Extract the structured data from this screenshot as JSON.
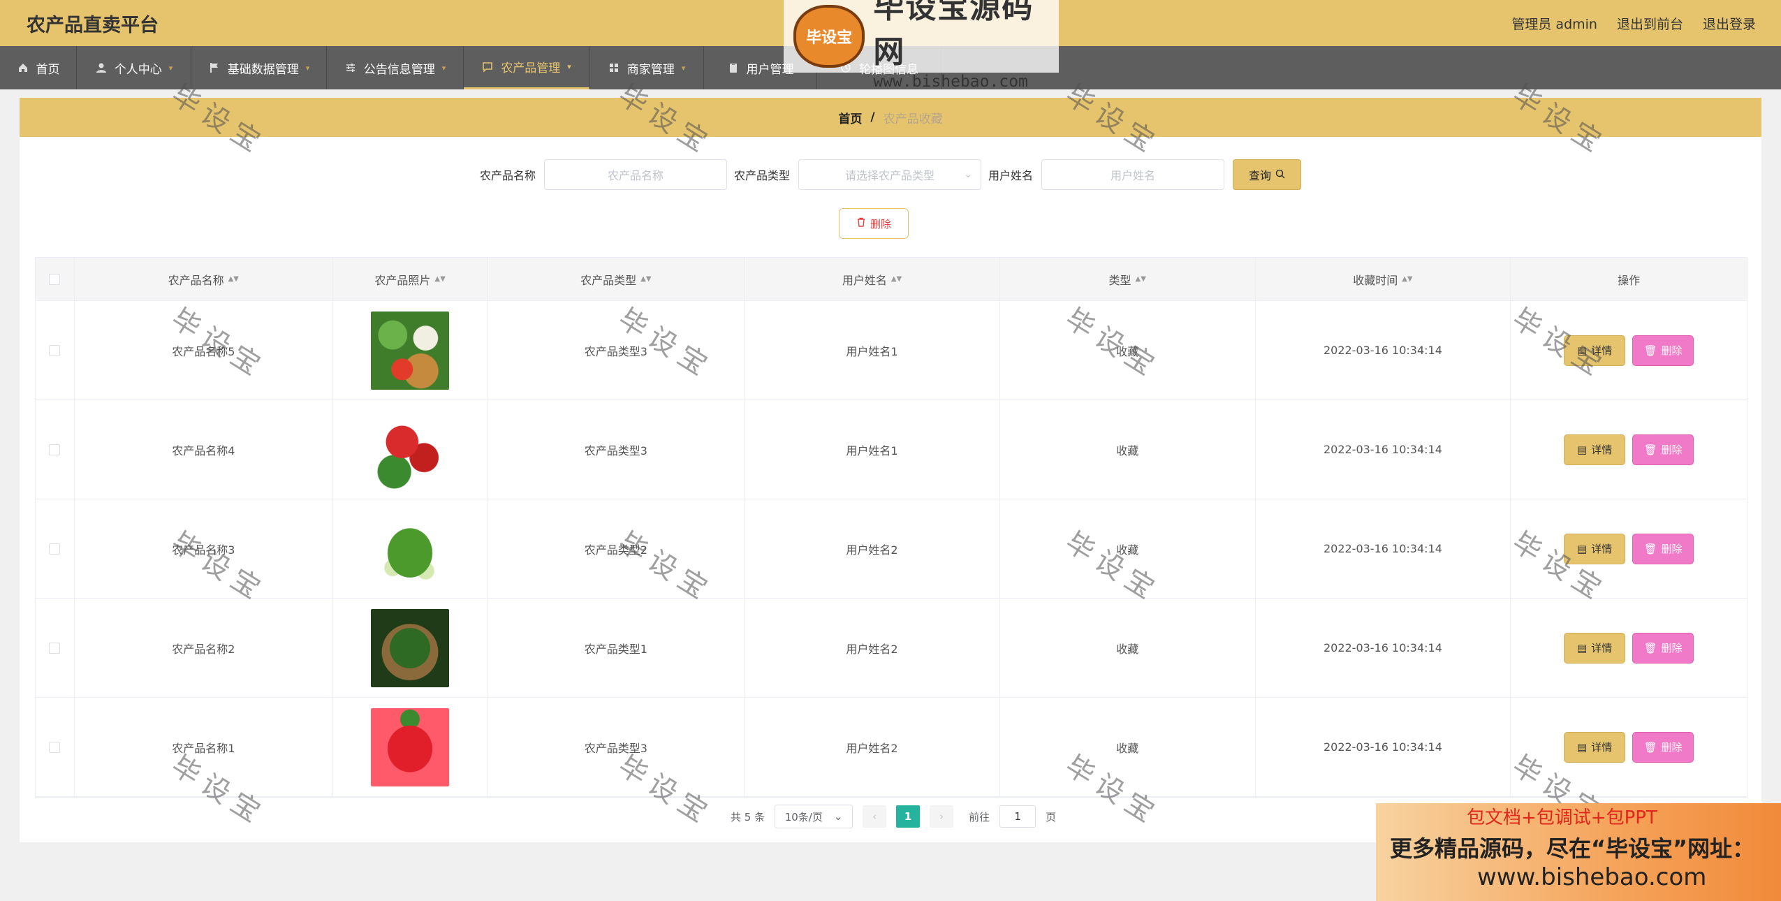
{
  "header": {
    "app_title": "农产品直卖平台",
    "admin_label": "管理员 admin",
    "front_link": "退出到前台",
    "logout_link": "退出登录"
  },
  "nav": [
    {
      "label": "首页",
      "icon": "home-icon",
      "dropdown": false,
      "active": false
    },
    {
      "label": "个人中心",
      "icon": "user-icon",
      "dropdown": true,
      "active": false
    },
    {
      "label": "基础数据管理",
      "icon": "flag-icon",
      "dropdown": true,
      "active": false
    },
    {
      "label": "公告信息管理",
      "icon": "sliders-icon",
      "dropdown": true,
      "active": false
    },
    {
      "label": "农产品管理",
      "icon": "message-icon",
      "dropdown": true,
      "active": true
    },
    {
      "label": "商家管理",
      "icon": "grid-icon",
      "dropdown": true,
      "active": false
    },
    {
      "label": "用户管理",
      "icon": "clipboard-icon",
      "dropdown": false,
      "active": false
    },
    {
      "label": "轮播图信息",
      "icon": "clock-icon",
      "dropdown": false,
      "active": false
    }
  ],
  "watermark": {
    "badge": "毕设宝",
    "main": "毕设宝源码网",
    "url": "www.bishebao.com",
    "overlay_text": "毕设宝"
  },
  "breadcrumb": {
    "home": "首页",
    "separator": "/",
    "current": "农产品收藏"
  },
  "filters": {
    "name_label": "农产品名称",
    "name_placeholder": "农产品名称",
    "type_label": "农产品类型",
    "type_placeholder": "请选择农产品类型",
    "user_label": "用户姓名",
    "user_placeholder": "用户姓名",
    "query_button": "查询"
  },
  "batch_delete_button": "删除",
  "table": {
    "columns": [
      "农产品名称",
      "农产品照片",
      "农产品类型",
      "用户姓名",
      "类型",
      "收藏时间",
      "操作"
    ],
    "rows": [
      {
        "name": "农产品名称5",
        "type": "农产品类型3",
        "user": "用户姓名1",
        "kind": "收藏",
        "time": "2022-03-16 10:34:14"
      },
      {
        "name": "农产品名称4",
        "type": "农产品类型3",
        "user": "用户姓名1",
        "kind": "收藏",
        "time": "2022-03-16 10:34:14"
      },
      {
        "name": "农产品名称3",
        "type": "农产品类型2",
        "user": "用户姓名2",
        "kind": "收藏",
        "time": "2022-03-16 10:34:14"
      },
      {
        "name": "农产品名称2",
        "type": "农产品类型1",
        "user": "用户姓名2",
        "kind": "收藏",
        "time": "2022-03-16 10:34:14"
      },
      {
        "name": "农产品名称1",
        "type": "农产品类型3",
        "user": "用户姓名2",
        "kind": "收藏",
        "time": "2022-03-16 10:34:14"
      }
    ],
    "detail_button": "详情",
    "delete_button": "删除"
  },
  "pagination": {
    "total": "共 5 条",
    "page_size": "10条/页",
    "current_page": "1",
    "goto_label": "前往",
    "goto_value": "1",
    "page_suffix": "页"
  },
  "promo": {
    "line1": "包文档+包调试+包PPT",
    "line2": "更多精品源码，尽在“毕设宝”网址：",
    "line3": "www.bishebao.com"
  },
  "colors": {
    "accent": "#e6c46e",
    "nav_bg": "#5e5e5e",
    "delete_pink": "#f07ac8",
    "pager_active": "#25b39e"
  }
}
